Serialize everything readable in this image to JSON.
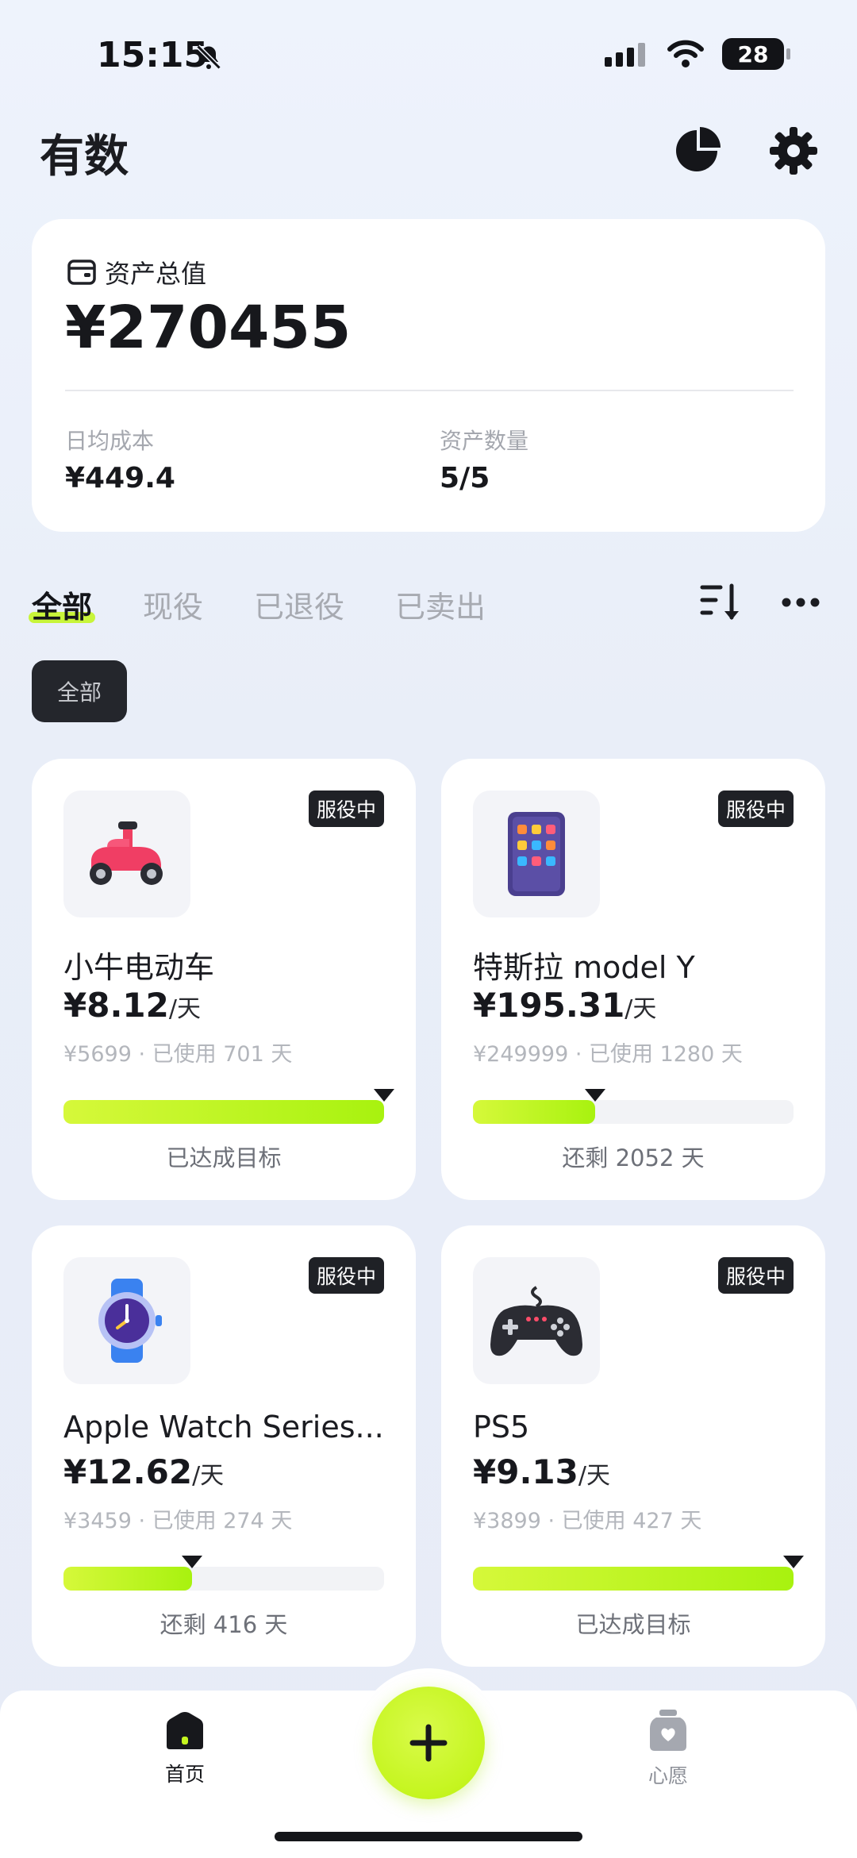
{
  "status_bar": {
    "time": "15:15",
    "battery": "28"
  },
  "header": {
    "title": "有数"
  },
  "summary": {
    "label": "资产总值",
    "total": "¥270455",
    "daily_cost_label": "日均成本",
    "daily_cost_value": "¥449.4",
    "asset_count_label": "资产数量",
    "asset_count_value": "5/5"
  },
  "tabs": [
    {
      "label": "全部",
      "active": true
    },
    {
      "label": "现役",
      "active": false
    },
    {
      "label": "已退役",
      "active": false
    },
    {
      "label": "已卖出",
      "active": false
    }
  ],
  "filter_chip": "全部",
  "assets": [
    {
      "name": "小牛电动车",
      "badge": "服役中",
      "daily": "¥8.12",
      "unit": "/天",
      "meta": "¥5699 · 已使用 701 天",
      "progress": 1.0,
      "progress_text": "已达成目标",
      "icon": "scooter-icon"
    },
    {
      "name": "特斯拉 model Y",
      "badge": "服役中",
      "daily": "¥195.31",
      "unit": "/天",
      "meta": "¥249999 · 已使用 1280 天",
      "progress": 0.38,
      "progress_text": "还剩 2052 天",
      "icon": "tablet-icon"
    },
    {
      "name": "Apple Watch Series...",
      "badge": "服役中",
      "daily": "¥12.62",
      "unit": "/天",
      "meta": "¥3459 · 已使用 274 天",
      "progress": 0.4,
      "progress_text": "还剩 416 天",
      "icon": "watch-icon"
    },
    {
      "name": "PS5",
      "badge": "服役中",
      "daily": "¥9.13",
      "unit": "/天",
      "meta": "¥3899 · 已使用 427 天",
      "progress": 1.0,
      "progress_text": "已达成目标",
      "icon": "gamepad-icon"
    }
  ],
  "bottom_nav": {
    "home_label": "首页",
    "wishlist_label": "心愿",
    "add_label": "+"
  },
  "colors": {
    "accent": "#c5f51f",
    "card": "#ffffff",
    "background": "#eaeff9"
  }
}
